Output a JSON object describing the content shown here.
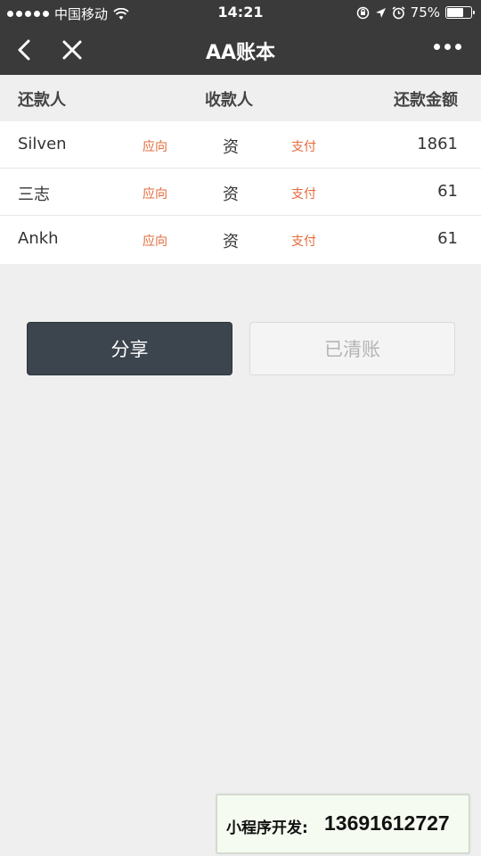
{
  "status_bar": {
    "carrier": "中国移动",
    "time": "14:21",
    "battery_percent": "75%",
    "battery_level": 0.75
  },
  "nav": {
    "title": "AA账本"
  },
  "table": {
    "headers": [
      "还款人",
      "收款人",
      "还款金额"
    ],
    "rows": [
      {
        "payer": "Silven",
        "verb1": "应向",
        "payee": "资",
        "verb2": "支付",
        "amount": "1861"
      },
      {
        "payer": "三志",
        "verb1": "应向",
        "payee": "资",
        "verb2": "支付",
        "amount": "61"
      },
      {
        "payer": "Ankh",
        "verb1": "应向",
        "payee": "资",
        "verb2": "支付",
        "amount": "61"
      }
    ]
  },
  "actions": {
    "share_label": "分享",
    "settled_label": "已清账"
  },
  "banner": {
    "label": "小程序开发:",
    "number": "13691612727"
  },
  "colors": {
    "nav_bg": "#3a3a3a",
    "accent_orange": "#e56b3c",
    "share_button": "#3c444d"
  }
}
